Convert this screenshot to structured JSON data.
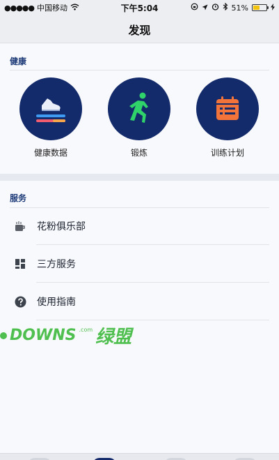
{
  "status_bar": {
    "carrier": "中国移动",
    "time": "下午5:04",
    "battery": "51%",
    "battery_level": 0.51
  },
  "nav": {
    "title": "发现"
  },
  "health": {
    "label": "健康",
    "tiles": [
      {
        "label": "健康数据",
        "icon": "shoe-icon"
      },
      {
        "label": "锻炼",
        "icon": "runner-icon"
      },
      {
        "label": "训练计划",
        "icon": "calendar-icon"
      }
    ]
  },
  "services": {
    "label": "服务",
    "items": [
      {
        "label": "花粉俱乐部",
        "icon": "cup-icon"
      },
      {
        "label": "三方服务",
        "icon": "grid-icon"
      },
      {
        "label": "使用指南",
        "icon": "help-icon"
      }
    ]
  },
  "watermark": {
    "text": "DOWNS",
    "text2": "绿盟",
    "suffix": ".com"
  },
  "colors": {
    "accent": "#132a6b",
    "run_green": "#2fd36a",
    "calendar_orange": "#f2743a",
    "watermark_green": "#4fbf4f"
  }
}
